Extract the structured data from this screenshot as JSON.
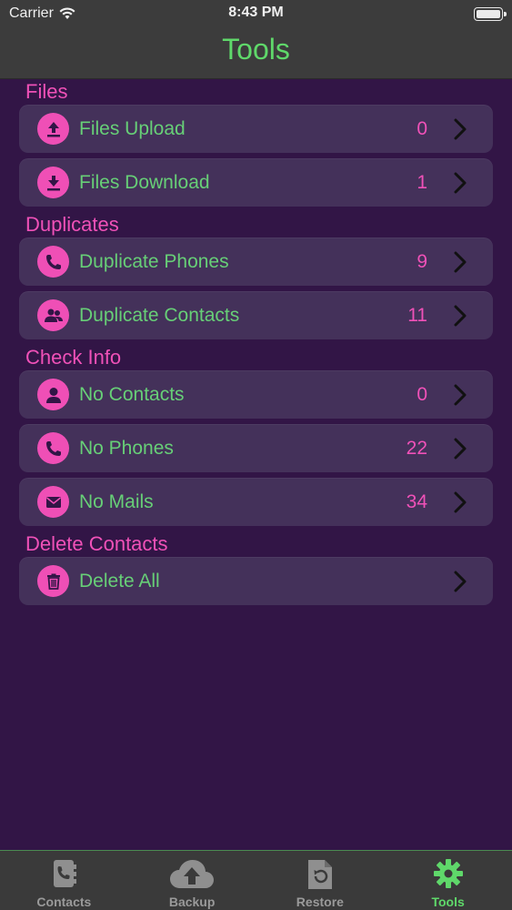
{
  "status_bar": {
    "carrier": "Carrier",
    "time": "8:43 PM"
  },
  "nav": {
    "title": "Tools"
  },
  "colors": {
    "accent_pink": "#ef4fb6",
    "label_green": "#67cf77",
    "title_green": "#5fd86a",
    "background": "#321546",
    "row_bg": "#44315a"
  },
  "sections": [
    {
      "title": "Files",
      "rows": [
        {
          "label": "Files Upload",
          "count": "0",
          "icon": "upload-icon"
        },
        {
          "label": "Files Download",
          "count": "1",
          "icon": "download-icon"
        }
      ]
    },
    {
      "title": "Duplicates",
      "rows": [
        {
          "label": "Duplicate Phones",
          "count": "9",
          "icon": "phone-icon"
        },
        {
          "label": "Duplicate Contacts",
          "count": "11",
          "icon": "contacts-icon"
        }
      ]
    },
    {
      "title": "Check Info",
      "rows": [
        {
          "label": "No Contacts",
          "count": "0",
          "icon": "person-icon"
        },
        {
          "label": "No Phones",
          "count": "22",
          "icon": "phone-icon"
        },
        {
          "label": "No Mails",
          "count": "34",
          "icon": "mail-icon"
        }
      ]
    },
    {
      "title": "Delete Contacts",
      "rows": [
        {
          "label": "Delete All",
          "count": "",
          "icon": "trash-icon"
        }
      ]
    }
  ],
  "tabs": [
    {
      "label": "Contacts",
      "icon": "contacts-book-icon",
      "active": false
    },
    {
      "label": "Backup",
      "icon": "cloud-upload-icon",
      "active": false
    },
    {
      "label": "Restore",
      "icon": "restore-file-icon",
      "active": false
    },
    {
      "label": "Tools",
      "icon": "gear-icon",
      "active": true
    }
  ]
}
